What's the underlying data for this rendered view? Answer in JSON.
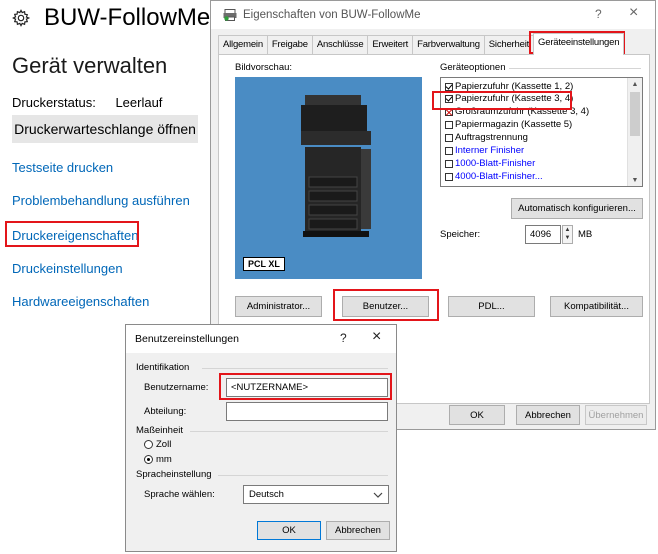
{
  "left_panel": {
    "title": "BUW-FollowMe",
    "heading": "Gerät verwalten",
    "status_label": "Druckerstatus:",
    "status_value": "Leerlauf",
    "queue_button": "Druckerwarteschlange öffnen",
    "links": [
      "Testseite drucken",
      "Problembehandlung ausführen",
      "Druckereigenschaften",
      "Druckeinstellungen",
      "Hardwareeigenschaften"
    ]
  },
  "properties_dialog": {
    "title": "Eigenschaften von BUW-FollowMe",
    "help": "?",
    "close": "×",
    "tabs": [
      "Allgemein",
      "Freigabe",
      "Anschlüsse",
      "Erweitert",
      "Farbverwaltung",
      "Sicherheit",
      "Geräteeinstellungen"
    ],
    "active_tab": "Geräteeinstellungen",
    "preview_label": "Bildvorschau:",
    "pcl_badge": "PCL XL",
    "options_label": "Geräteoptionen",
    "options": [
      {
        "label": "Papierzufuhr (Kassette 1, 2)",
        "state": "checked"
      },
      {
        "label": "Papierzufuhr (Kassette 3, 4)",
        "state": "checked"
      },
      {
        "label": "Großraumzufuhr (Kassette 3, 4)",
        "state": "crossed"
      },
      {
        "label": "Papiermagazin (Kassette 5)",
        "state": "unchecked"
      },
      {
        "label": "Auftragstrennung",
        "state": "unchecked"
      },
      {
        "label": "Interner Finisher",
        "state": "unchecked"
      },
      {
        "label": "1000-Blatt-Finisher",
        "state": "unchecked"
      },
      {
        "label": "4000-Blatt-Finisher...",
        "state": "unchecked"
      }
    ],
    "auto_config_button": "Automatisch konfigurieren...",
    "memory_label": "Speicher:",
    "memory_value": "4096",
    "memory_unit": "MB",
    "bottom_buttons": [
      "Administrator...",
      "Benutzer...",
      "PDL...",
      "Kompatibilität..."
    ],
    "ok": "OK",
    "cancel": "Abbrechen",
    "apply": "Übernehmen"
  },
  "user_dialog": {
    "title": "Benutzereinstellungen",
    "help": "?",
    "close": "×",
    "section_identification": "Identifikation",
    "username_label": "Benutzername:",
    "username_value": "<NUTZERNAME>",
    "department_label": "Abteilung:",
    "department_value": "",
    "section_unit": "Maßeinheit",
    "unit_options": [
      "Zoll",
      "mm"
    ],
    "unit_selected": "mm",
    "section_language": "Spracheinstellung",
    "language_label": "Sprache wählen:",
    "language_value": "Deutsch",
    "ok": "OK",
    "cancel": "Abbrechen"
  },
  "colors": {
    "highlight": "#e3151a",
    "link": "#0067b8",
    "preview_bg": "#4a8cc4",
    "blue_option": "#0000ff"
  }
}
